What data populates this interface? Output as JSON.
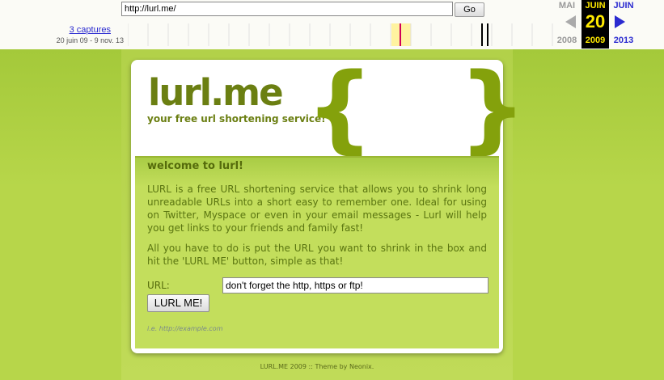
{
  "toolbar": {
    "url_value": "http://lurl.me/",
    "go_label": "Go",
    "captures_label": "3 captures",
    "date_range": "20 juin 09 - 9 nov. 13",
    "prev": {
      "month": "MAI",
      "year": "2008"
    },
    "current": {
      "month": "JUIN",
      "day": "20",
      "year": "2009"
    },
    "next": {
      "month": "JUIN",
      "year": "2013"
    },
    "colors": {
      "highlight": "#fff3a0",
      "capture_mark": "#d0005a",
      "link": "#2a2ad0"
    }
  },
  "site": {
    "logo": "lurl.me",
    "tagline": "your free url shortening service!",
    "brace_left": "{",
    "brace_right": "}",
    "heading": "welcome to lurl!",
    "para1": "LURL is a free URL shortening service that allows you to shrink long unreadable URLs into a short easy to remember one. Ideal for using on Twitter, Myspace or even in your email messages - Lurl will help you get links to your friends and family fast!",
    "para2": "All you have to do is put the URL you want to shrink in the box and hit the 'LURL ME' button, simple as that!",
    "url_label": "URL:",
    "url_input_value": "don't forget the http, https or ftp!",
    "button_label": "LURL ME!",
    "example": "i.e. http://example.com",
    "footer": "LURL.ME 2009 :: Theme by Neonix.",
    "colors": {
      "accent": "#84a10c",
      "text": "#5a7510",
      "background": "#b7d64a"
    }
  }
}
